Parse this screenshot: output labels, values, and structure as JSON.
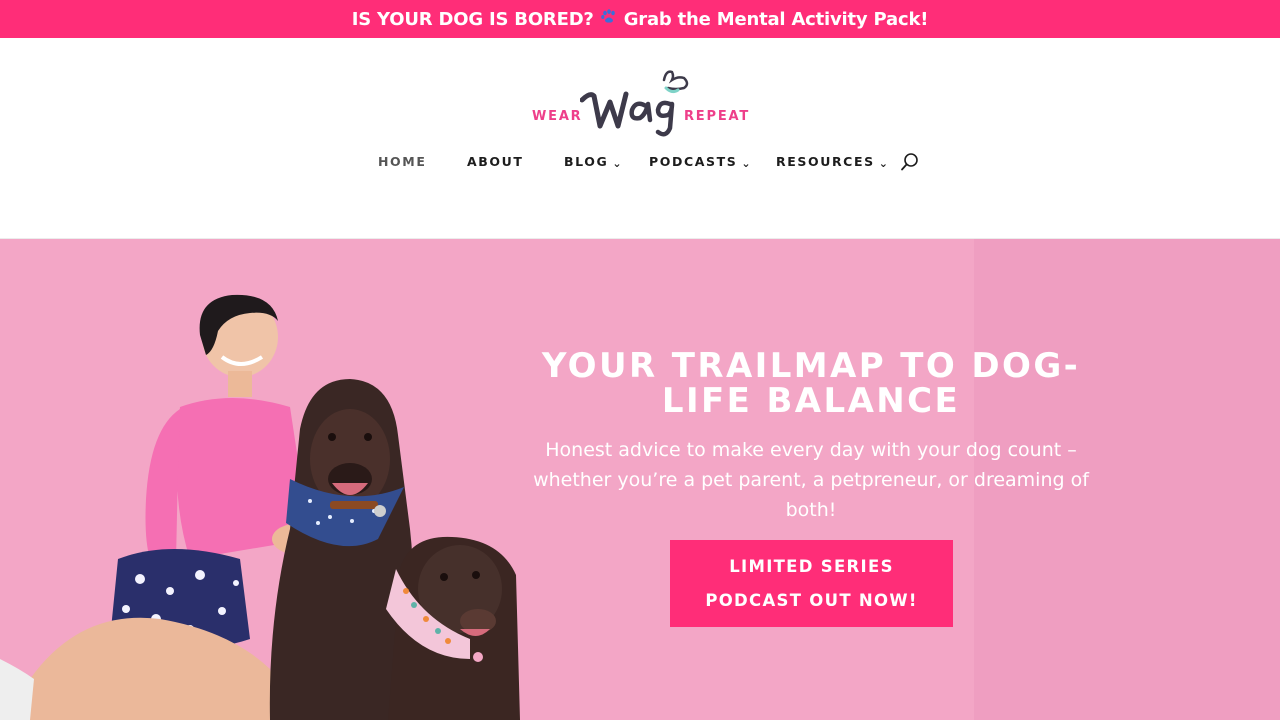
{
  "promo_banner": {
    "text_before": "IS YOUR DOG IS BORED?",
    "icon": "paw-prints-icon",
    "text_after": "Grab the Mental Activity Pack!",
    "background": "#ff2d78"
  },
  "logo": {
    "left_word": "WEAR",
    "center_word": "wag",
    "right_word": "REPEAT",
    "accent_color": "#ee3f8a"
  },
  "nav": {
    "items": [
      {
        "label": "HOME",
        "has_dropdown": false,
        "active": true
      },
      {
        "label": "ABOUT",
        "has_dropdown": false,
        "active": false
      },
      {
        "label": "BLOG",
        "has_dropdown": true,
        "active": false
      },
      {
        "label": "PODCASTS",
        "has_dropdown": true,
        "active": false
      },
      {
        "label": "RESOURCES",
        "has_dropdown": true,
        "active": false
      }
    ],
    "dropdown_glyph": "⌄",
    "search_icon": "search-icon"
  },
  "hero": {
    "title": "YOUR TRAILMAP TO DOG-LIFE BALANCE",
    "subtitle": "Honest advice to make every day with your dog count – whether you’re a pet parent, a petpreneur, or dreaming of both!",
    "cta_label": "LIMITED SERIES PODCAST OUT NOW!",
    "background": "#f3a6c6",
    "cta_color": "#ff2d78"
  }
}
